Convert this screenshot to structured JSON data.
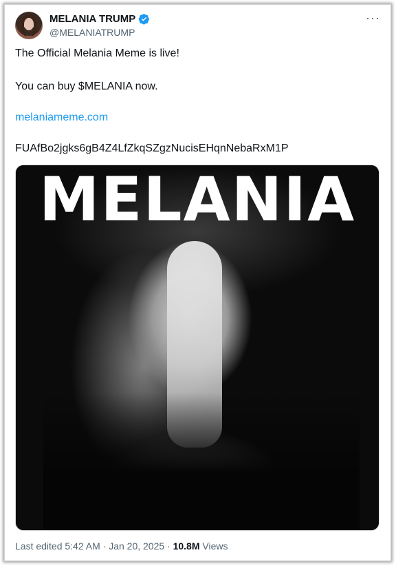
{
  "account": {
    "name": "MELANIA TRUMP",
    "handle": "@MELANIATRUMP",
    "verified_color": "#1d9bf0"
  },
  "post": {
    "line1": "The Official Melania Meme is live!",
    "line2": "You can buy $MELANIA now.",
    "link": "melaniameme.com",
    "contract": "FUAfBo2jgks6gB4Z4LfZkqSZgzNucisEHqnNebaRxM1P"
  },
  "media": {
    "wordmark": "MELANIA"
  },
  "footer": {
    "edited": "Last edited 5:42 AM · Jan 20, 2025 · ",
    "views_count": "10.8M",
    "views_label": " Views"
  },
  "icons": {
    "more": "more-icon",
    "verified": "verified-badge-icon"
  }
}
